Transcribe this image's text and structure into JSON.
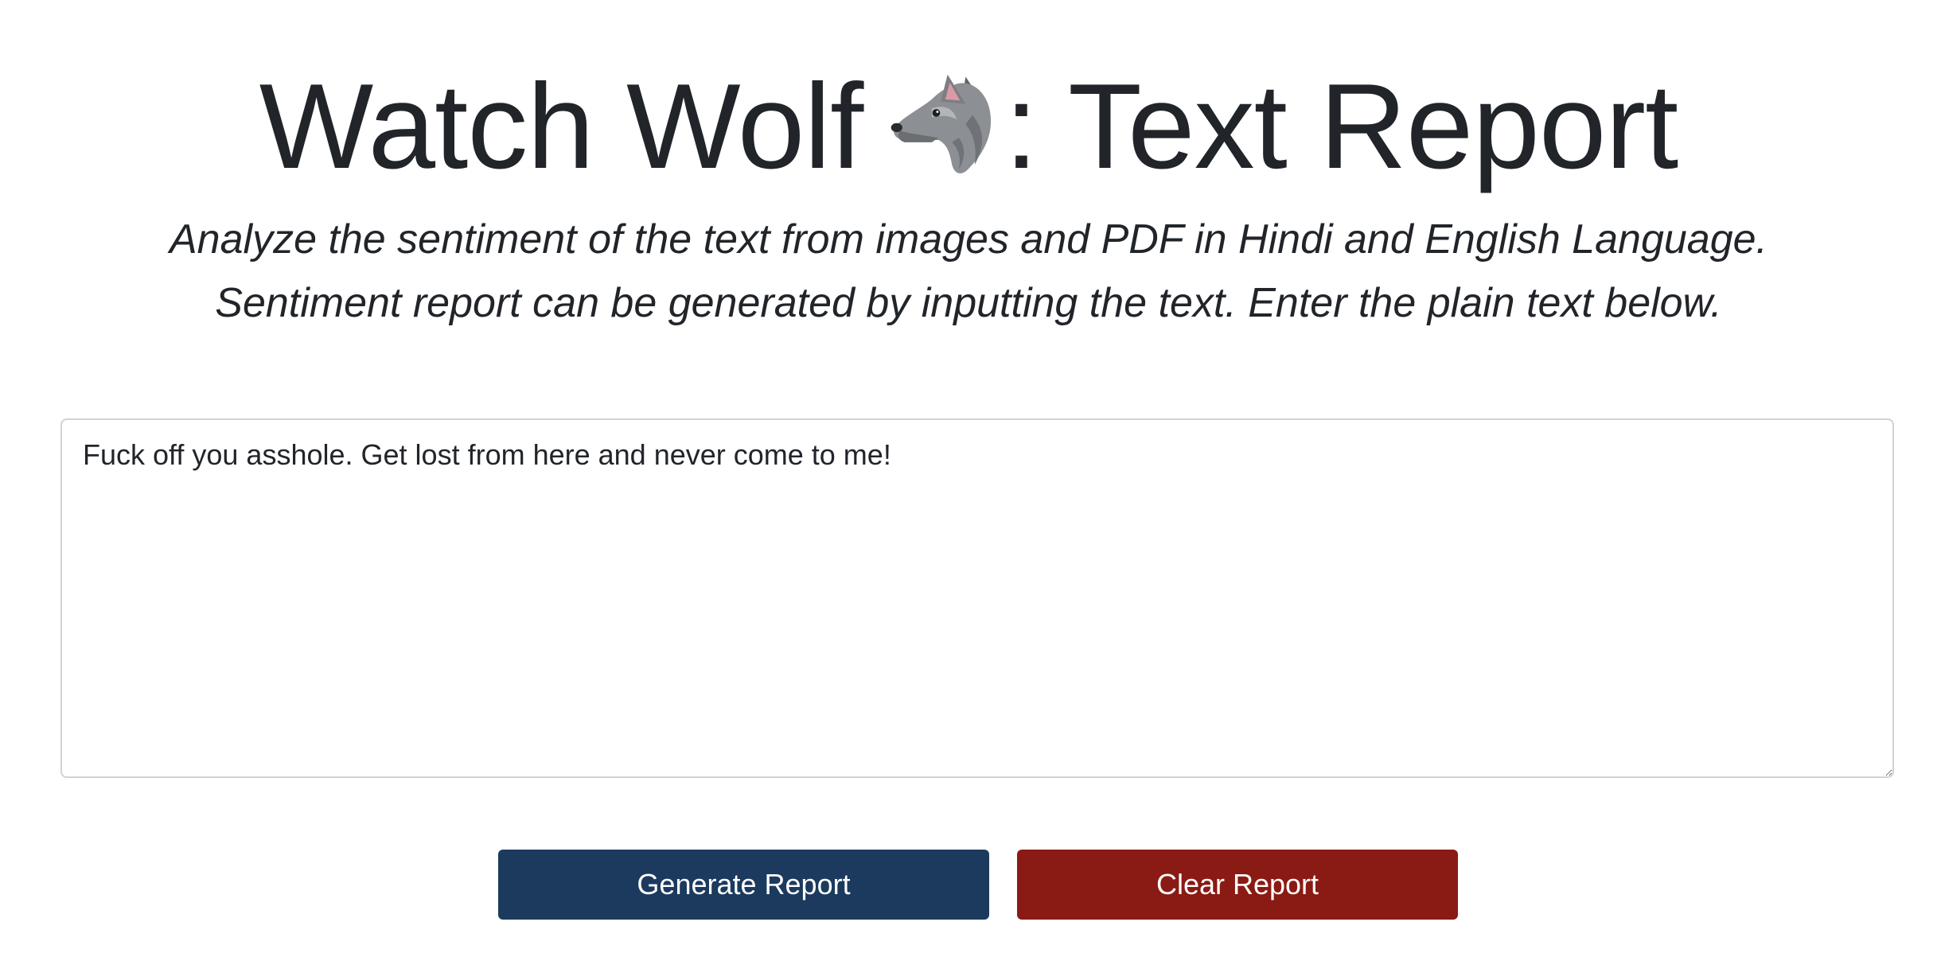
{
  "header": {
    "title_prefix": "Watch Wolf",
    "title_suffix": ": Text Report",
    "title_icon": "wolf-face-emoji"
  },
  "description": {
    "line1": "Analyze the sentiment of the text from images and PDF in Hindi and English Language.",
    "line2": "Sentiment report can be generated by inputting the text. Enter the plain text below."
  },
  "input": {
    "value": "Fuck off you asshole. Get lost from here and never come to me!"
  },
  "actions": {
    "generate_label": "Generate Report",
    "clear_label": "Clear Report"
  },
  "colors": {
    "generate_button": "#1b3a5e",
    "clear_button": "#8a1a14",
    "text": "#212529"
  }
}
